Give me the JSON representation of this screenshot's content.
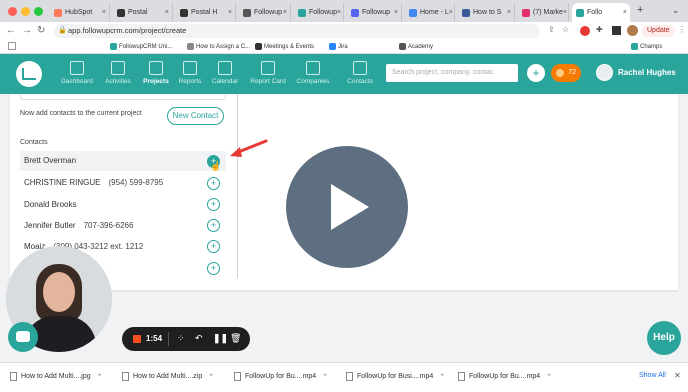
{
  "browser": {
    "tabs": [
      {
        "label": "HubSpot",
        "color": "#ff7a59"
      },
      {
        "label": "Postal",
        "color": "#333333"
      },
      {
        "label": "Postal H",
        "color": "#333333"
      },
      {
        "label": "Followup",
        "color": "#555555"
      },
      {
        "label": "Followup",
        "color": "#2aa59c"
      },
      {
        "label": "Followup",
        "color": "#5865f2"
      },
      {
        "label": "Home - L",
        "color": "#4285f4"
      },
      {
        "label": "How to S",
        "color": "#3b5998"
      },
      {
        "label": "(7) Marke",
        "color": "#e1306c"
      },
      {
        "label": "Follo",
        "color": "#2aa59c"
      }
    ],
    "new_tab": "+",
    "url": "app.followupcrm.com/project/create",
    "update_label": "Update",
    "bookmarks": [
      {
        "label": "FollowupCRM Uni...",
        "color": "#2aa59c"
      },
      {
        "label": "How to Assign a C...",
        "color": "#888888"
      },
      {
        "label": "Meetings & Events",
        "color": "#333333"
      },
      {
        "label": "Jira",
        "color": "#2684ff"
      },
      {
        "label": "Academy",
        "color": "#555555"
      },
      {
        "label": "Champs",
        "color": "#2aa59c"
      }
    ]
  },
  "app": {
    "nav": [
      {
        "label": "Dashboard",
        "icon": "bar-chart-icon"
      },
      {
        "label": "Activities",
        "icon": "checklist-icon"
      },
      {
        "label": "Projects",
        "icon": "folder-icon"
      },
      {
        "label": "Reports",
        "icon": "target-icon"
      },
      {
        "label": "Calendar",
        "icon": "calendar-icon"
      },
      {
        "label": "Report Card",
        "icon": "report-card-icon"
      },
      {
        "label": "Companies",
        "icon": "building-icon"
      },
      {
        "label": "Contacts",
        "icon": "person-icon"
      }
    ],
    "active_nav": "Projects",
    "search_placeholder": "Search project, company, contac",
    "notification_count": "72",
    "user_name": "Rachel Hughes"
  },
  "panel": {
    "hint": "Now add contacts to the current project",
    "new_contact": "New Contact",
    "contacts_heading": "Contacts",
    "contacts": [
      {
        "name": "Brett Overman",
        "phone": ""
      },
      {
        "name": "CHRISTINE RINGUE",
        "phone": "(954) 599-8795"
      },
      {
        "name": "Donald Brooks",
        "phone": ""
      },
      {
        "name": "Jennifer Butler",
        "phone": "707-396-6266"
      },
      {
        "name": "Moaiz",
        "phone": "(309) 043-3212 ext. 1212"
      }
    ]
  },
  "recorder": {
    "time": "1:54"
  },
  "help_label": "Help",
  "downloads": {
    "items": [
      "How to Add Multi....jpg",
      "How to Add Multi....zip",
      "FollowUp for Bu....mp4",
      "FollowUp for Busi....mp4",
      "FollowUp for Bu....mp4"
    ],
    "show_all": "Show All"
  },
  "colors": {
    "accent": "#2aa59c",
    "play": "#5d6f80",
    "arrow": "#e53935"
  }
}
